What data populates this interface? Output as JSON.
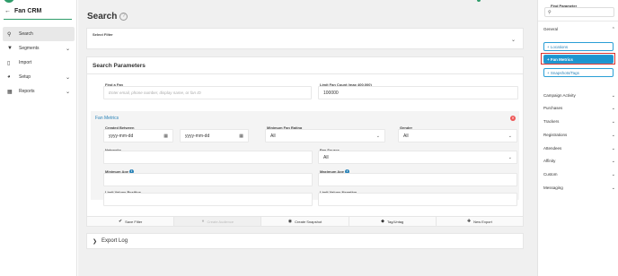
{
  "app": {
    "title": "Fan CRM",
    "back_icon": "back-arrow-icon",
    "brand_color": "#2e9c6a"
  },
  "sidebar": {
    "items": [
      {
        "label": "Search",
        "icon": "search-icon",
        "active": true
      },
      {
        "label": "Segments",
        "icon": "funnel-icon",
        "chevron": true
      },
      {
        "label": "Import",
        "icon": "import-icon"
      },
      {
        "label": "Setup",
        "icon": "toggle-icon",
        "chevron": true
      },
      {
        "label": "Reports",
        "icon": "chart-icon",
        "chevron": true
      }
    ]
  },
  "page": {
    "title": "Search",
    "help_icon": "?"
  },
  "select_filter": {
    "label": "Select Filter",
    "value": ""
  },
  "search_params": {
    "heading": "Search Parameters",
    "find_fan_label": "Find a Fan",
    "find_fan_placeholder": "Enter email, phone number, display name, or fan ID",
    "limit_label": "Limit Fan Count (max 400,000)",
    "limit_value": "100000"
  },
  "fan_metrics": {
    "title": "Fan Metrics",
    "created_between_label": "Created Between",
    "date_from_placeholder": "yyyy-mm-dd",
    "date_to_placeholder": "yyyy-mm-dd",
    "min_rating_label": "Minimum Fan Rating",
    "min_rating_value": "All",
    "gender_label": "Gender",
    "gender_value": "All",
    "networks_label": "Networks",
    "networks_value": "",
    "fan_source_label": "Fan Source",
    "fan_source_value": "All",
    "min_age_label": "Minimum Age",
    "max_age_label": "Maximum Age",
    "limit_positive_label": "Limit Values Positive",
    "limit_negative_label": "Limit Values Negative"
  },
  "actions": {
    "save": "Save Filter",
    "create_audience": "Create Audience",
    "snapshot": "Create Snapshot",
    "tag": "Tag/Untag",
    "export": "New Export"
  },
  "export_log": {
    "label": "Export Log"
  },
  "right_panel": {
    "find_label": "Find Parameter",
    "find_placeholder": "",
    "general": "General",
    "tags": [
      {
        "label": "+ Locations",
        "active": false
      },
      {
        "label": "+ Fan Metrics",
        "active": true
      },
      {
        "label": "+ Snapshots/Tags",
        "active": false
      }
    ],
    "groups": [
      "Campaign Activity",
      "Purchases",
      "Trackers",
      "Registrations",
      "Attendees",
      "Affinity",
      "Custom",
      "Messaging"
    ],
    "accent": "#1d95cf",
    "highlight": "#d9322e"
  }
}
